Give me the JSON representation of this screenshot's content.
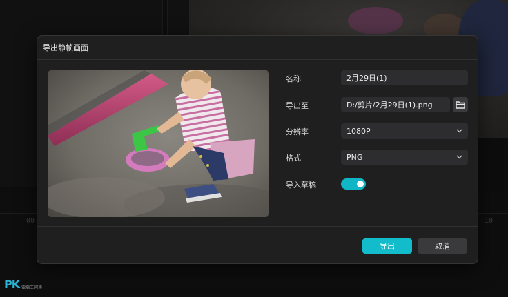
{
  "background": {
    "timeline_tick_left": "00",
    "timeline_tick_right": "10"
  },
  "dialog": {
    "title": "导出静帧画面",
    "fields": {
      "name_label": "名称",
      "name_value": "2月29日(1)",
      "export_to_label": "导出至",
      "export_to_value": "D:/剪片/2月29日(1).png",
      "resolution_label": "分辨率",
      "resolution_value": "1080P",
      "format_label": "格式",
      "format_value": "PNG",
      "import_draft_label": "导入草稿",
      "import_draft_on": true
    },
    "buttons": {
      "export": "导出",
      "cancel": "取消"
    },
    "icons": {
      "folder": "folder-icon",
      "chevron": "chevron-down-icon"
    },
    "colors": {
      "accent": "#12bccb",
      "dialog_bg": "#1f1f1f",
      "field_bg": "#2d2d2f"
    }
  },
  "watermark": {
    "logo": "PK",
    "sub": "電腦王阿達"
  }
}
